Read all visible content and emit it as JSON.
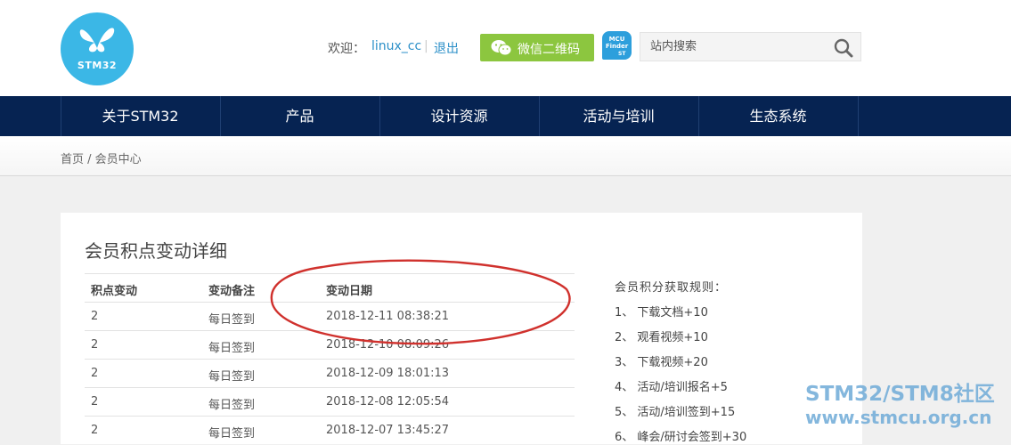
{
  "header": {
    "logo_text": "STM32",
    "welcome_label": "欢迎：",
    "username": "linux_cc",
    "separator": "|",
    "logout_label": "退出",
    "wechat_button_label": "微信二维码",
    "mcu_finder": {
      "line1": "MCU",
      "line2": "Finder",
      "line3": "ST"
    },
    "search_placeholder": "站内搜索",
    "colors": {
      "logo": "#3bb7e6",
      "wechat": "#8cc63f",
      "nav": "#062352",
      "link": "#2b8fc8"
    }
  },
  "nav": {
    "items": [
      {
        "label": "关于STM32"
      },
      {
        "label": "产品"
      },
      {
        "label": "设计资源"
      },
      {
        "label": "活动与培训"
      },
      {
        "label": "生态系统"
      }
    ]
  },
  "breadcrumb": {
    "text": "首页 / 会员中心"
  },
  "points": {
    "title": "会员积点变动详细",
    "columns": [
      "积点变动",
      "变动备注",
      "变动日期"
    ],
    "rows": [
      {
        "change": "2",
        "note": "每日签到",
        "date": "2018-12-11 08:38:21"
      },
      {
        "change": "2",
        "note": "每日签到",
        "date": "2018-12-10 08:09:26"
      },
      {
        "change": "2",
        "note": "每日签到",
        "date": "2018-12-09 18:01:13"
      },
      {
        "change": "2",
        "note": "每日签到",
        "date": "2018-12-08 12:05:54"
      },
      {
        "change": "2",
        "note": "每日签到",
        "date": "2018-12-07 13:45:27"
      }
    ]
  },
  "rules": {
    "title": "会员积分获取规则：",
    "items": [
      "1、 下载文档+10",
      "2、 观看视频+10",
      "3、 下载视频+20",
      "4、 活动/培训报名+5",
      "5、 活动/培训签到+15",
      "6、 峰会/研讨会签到+30"
    ]
  },
  "watermark": {
    "line1": "STM32/STM8社区",
    "line2": "www.stmcu.org.cn"
  },
  "annotation": {
    "color": "#d0312d"
  }
}
